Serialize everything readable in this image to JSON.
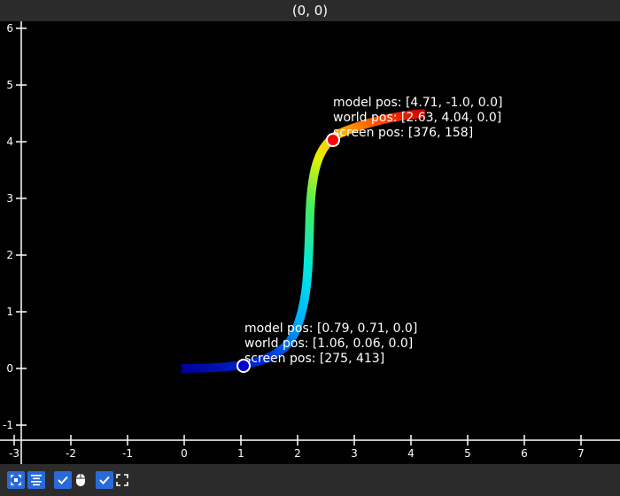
{
  "window": {
    "title": "(0, 0)"
  },
  "plot": {
    "x_ticks": [
      "-3",
      "-2",
      "-1",
      "0",
      "1",
      "2",
      "3",
      "4",
      "5",
      "6",
      "7"
    ],
    "y_ticks": [
      "-1",
      "0",
      "1",
      "2",
      "3",
      "4",
      "5",
      "6"
    ],
    "start_marker": {
      "model_pos": "model pos: [0.79, 0.71, 0.0]",
      "world_pos": "world pos: [1.06, 0.06, 0.0]",
      "screen_pos": "screen pos: [275, 413]"
    },
    "end_marker": {
      "model_pos": "model pos: [4.71, -1.0, 0.0]",
      "world_pos": "world pos: [2.63, 4.04, 0.0]",
      "screen_pos": "screen pos: [376, 158]"
    },
    "start_marker_color": "#0000cc",
    "end_marker_color": "#ff0000"
  },
  "toolbar": {
    "buttons": [
      {
        "icon": "pan-zoom-icon"
      },
      {
        "icon": "align-center-icon"
      },
      {
        "icon": "checkbox-icon"
      },
      {
        "icon": "mouse-icon"
      },
      {
        "icon": "checkbox-icon"
      },
      {
        "icon": "fullscreen-icon"
      }
    ]
  }
}
